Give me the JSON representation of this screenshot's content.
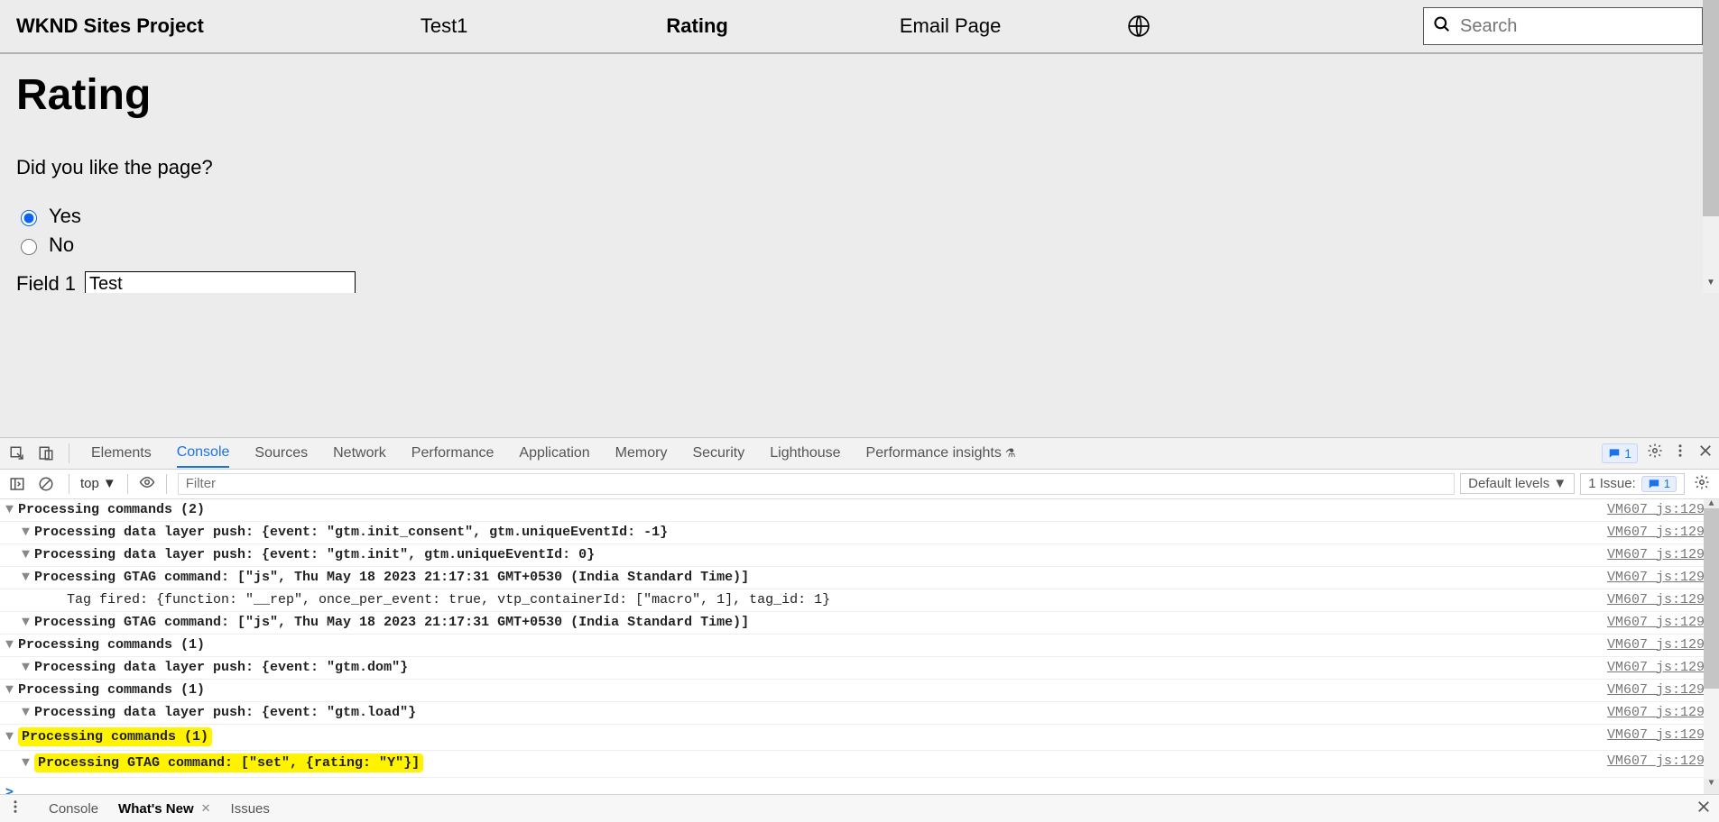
{
  "header": {
    "brand": "WKND Sites Project",
    "tabs": [
      "Test1",
      "Rating",
      "Email Page"
    ],
    "active_tab_index": 1,
    "search_placeholder": "Search"
  },
  "page": {
    "title": "Rating",
    "question": "Did you like the page?",
    "options": [
      {
        "label": "Yes",
        "checked": true
      },
      {
        "label": "No",
        "checked": false
      }
    ],
    "field1_label": "Field 1",
    "field1_value": "Test"
  },
  "devtools": {
    "tabs": [
      "Elements",
      "Console",
      "Sources",
      "Network",
      "Performance",
      "Application",
      "Memory",
      "Security",
      "Lighthouse",
      "Performance insights"
    ],
    "active_tab": "Console",
    "chip_count": "1",
    "context": "top",
    "filter_placeholder": "Filter",
    "levels_label": "Default levels",
    "issue_label": "1 Issue:",
    "issue_count": "1",
    "source_link": "VM607_js:129",
    "rows": [
      {
        "indent": 0,
        "tri": "▼",
        "bold": true,
        "text": "Processing commands (2)"
      },
      {
        "indent": 1,
        "tri": "▼",
        "bold": true,
        "text": "Processing data layer push: {event: \"gtm.init_consent\", gtm.uniqueEventId: -1}"
      },
      {
        "indent": 1,
        "tri": "▼",
        "bold": true,
        "text": "Processing data layer push: {event: \"gtm.init\", gtm.uniqueEventId: 0}"
      },
      {
        "indent": 1,
        "tri": "▼",
        "bold": true,
        "text": "Processing GTAG command: [\"js\", Thu May 18 2023 21:17:31 GMT+0530 (India Standard Time)]"
      },
      {
        "indent": 3,
        "tri": "",
        "bold": false,
        "text": "Tag fired: {function: \"__rep\", once_per_event: true, vtp_containerId: [\"macro\", 1], tag_id: 1}"
      },
      {
        "indent": 1,
        "tri": "▼",
        "bold": true,
        "text": "Processing GTAG command: [\"js\", Thu May 18 2023 21:17:31 GMT+0530 (India Standard Time)]"
      },
      {
        "indent": 0,
        "tri": "▼",
        "bold": true,
        "text": "Processing commands (1)"
      },
      {
        "indent": 1,
        "tri": "▼",
        "bold": true,
        "text": "Processing data layer push: {event: \"gtm.dom\"}"
      },
      {
        "indent": 0,
        "tri": "▼",
        "bold": true,
        "text": "Processing commands (1)"
      },
      {
        "indent": 1,
        "tri": "▼",
        "bold": true,
        "text": "Processing data layer push: {event: \"gtm.load\"}"
      },
      {
        "indent": 0,
        "tri": "▼",
        "bold": true,
        "text": "Processing commands (1)",
        "hl": true
      },
      {
        "indent": 1,
        "tri": "▼",
        "bold": true,
        "text": "Processing GTAG command: [\"set\", {rating: \"Y\"}]",
        "hl": true
      }
    ],
    "drawer_tabs": [
      "Console",
      "What's New",
      "Issues"
    ],
    "drawer_active": "What's New"
  }
}
